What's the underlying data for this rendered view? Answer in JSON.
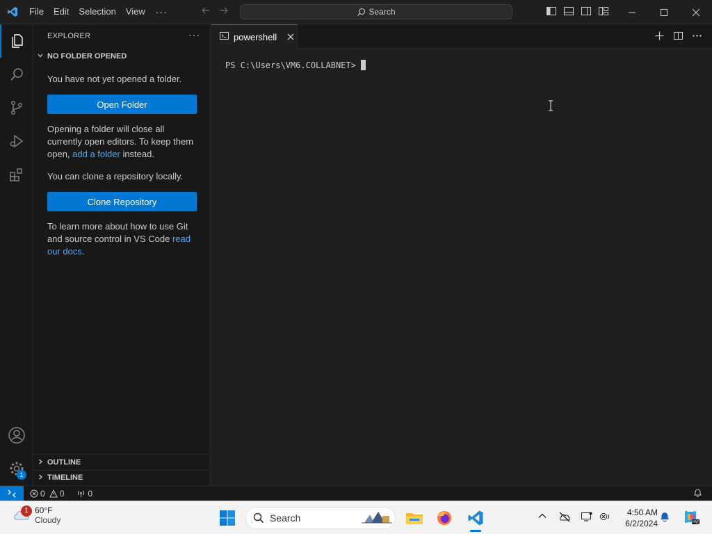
{
  "titlebar": {
    "menu": [
      "File",
      "Edit",
      "Selection",
      "View"
    ],
    "more": "···",
    "search_label": "Search"
  },
  "sidebar": {
    "title": "EXPLORER",
    "more": "···",
    "section_title": "NO FOLDER OPENED",
    "intro": "You have not yet opened a folder.",
    "open_folder_button": "Open Folder",
    "note_part1": "Opening a folder will close all currently open editors. To keep them open, ",
    "note_link": "add a folder",
    "note_part2": " instead.",
    "clone_text": "You can clone a repository locally.",
    "clone_button": "Clone Repository",
    "learn_part1": "To learn more about how to use Git and source control in VS Code ",
    "learn_link": "read our docs",
    "learn_part2": ".",
    "outline": "OUTLINE",
    "timeline": "TIMELINE"
  },
  "activity": {
    "settings_badge": "1"
  },
  "editor": {
    "tab_label": "powershell",
    "prompt": "PS C:\\Users\\VM6.COLLABNET>"
  },
  "statusbar": {
    "errors": "0",
    "warnings": "0",
    "ports": "0"
  },
  "taskbar": {
    "weather_temp": "60°F",
    "weather_cond": "Cloudy",
    "weather_badge": "1",
    "search_label": "Search",
    "time": "4:50 AM",
    "date": "6/2/2024"
  },
  "colors": {
    "accent": "#0078d4",
    "link": "#4daafc",
    "background": "#1f1f1f",
    "sidebar": "#181818"
  }
}
